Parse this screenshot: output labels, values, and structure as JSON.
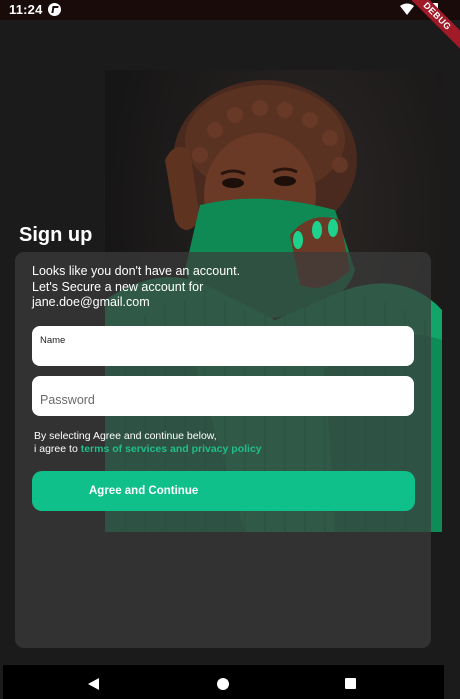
{
  "status_bar": {
    "time": "11:24",
    "icons": [
      "app-notification-icon",
      "wifi-icon",
      "battery-icon"
    ]
  },
  "debug_banner": "DEBUG",
  "page": {
    "title": "Sign up"
  },
  "card": {
    "intro_lines": [
      "Looks like you don't have an account.",
      "Let's Secure a new account for",
      "jane.doe@gmail.com"
    ],
    "name_field": {
      "label": "Name",
      "value": ""
    },
    "password_field": {
      "placeholder": "Password",
      "value": ""
    },
    "terms": {
      "line1": "By selecting Agree and continue below,",
      "line2_prefix": "i agree to ",
      "link": "terms of services and privacy policy"
    },
    "agree_button": "Agree and Continue"
  },
  "colors": {
    "accent": "#0fc08a",
    "link": "#1fbf8c",
    "background": "#1b1b1b",
    "debug": "#a01a28"
  },
  "nav_bar": {
    "icons": [
      "back-icon",
      "home-icon",
      "recents-icon"
    ]
  }
}
